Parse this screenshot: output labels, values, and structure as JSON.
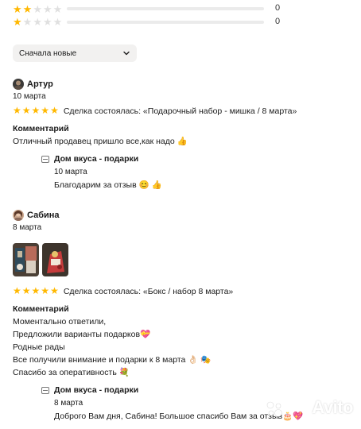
{
  "rating_bars": [
    {
      "stars": 2,
      "count": "0",
      "fill": 0
    },
    {
      "stars": 1,
      "count": "0",
      "fill": 0
    }
  ],
  "sort": {
    "label": "Сначала новые",
    "icon": "chevron-down-icon"
  },
  "reviews": [
    {
      "author": "Артур",
      "date": "10 марта",
      "rating": 5,
      "deal": "Сделка состоялась: «Подарочный набор - мишка / 8 марта»",
      "comment_title": "Комментарий",
      "comment_lines": [
        "Отличный продавец пришло все,как надо 👍"
      ],
      "reply": {
        "seller": "Дом вкуса - подарки",
        "date": "10 марта",
        "text": "Благодарим за отзыв 😊 👍"
      }
    },
    {
      "author": "Сабина",
      "date": "8 марта",
      "rating": 5,
      "photos": 2,
      "deal": "Сделка состоялась: «Бокс / набор 8 марта»",
      "comment_title": "Комментарий",
      "comment_lines": [
        "Моментально ответили,",
        "Предложили варианты подарков💝",
        "Родные рады",
        "Все получили внимание и подарки к 8 марта 👌🏻 🎭",
        "Спасибо за оперативность 💐"
      ],
      "reply": {
        "seller": "Дом вкуса - подарки",
        "date": "8 марта",
        "text": "Доброго Вам дня, Сабина! Большое спасибо Вам за отзыв🎂💖"
      }
    }
  ],
  "watermark": "Avito",
  "colors": {
    "star_on": "#ffb800",
    "star_off": "#e0e0e0",
    "sort_bg": "#f2f1f0"
  }
}
